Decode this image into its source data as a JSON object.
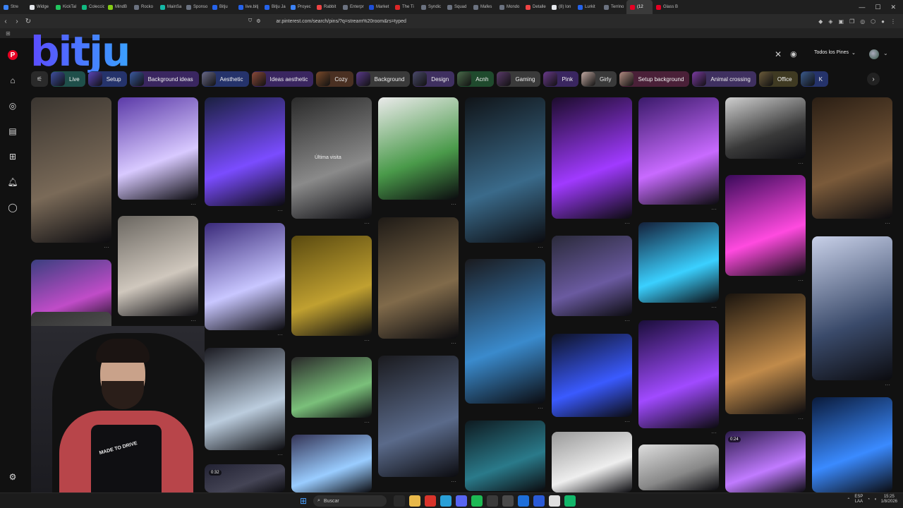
{
  "browser": {
    "tabs": [
      {
        "label": "Stre",
        "color": "#3b82f6"
      },
      {
        "label": "Widge",
        "color": "#e5e7eb"
      },
      {
        "label": "KickTal",
        "color": "#22c55e"
      },
      {
        "label": "Coleccio",
        "color": "#10b981"
      },
      {
        "label": "MindB",
        "color": "#84cc16"
      },
      {
        "label": "Rocko",
        "color": "#6b7280"
      },
      {
        "label": "MainSa",
        "color": "#14b8a6"
      },
      {
        "label": "Sponso",
        "color": "#6b7280"
      },
      {
        "label": "Bitju",
        "color": "#2563eb"
      },
      {
        "label": "live.bitj",
        "color": "#2563eb"
      },
      {
        "label": "Bitju Ja",
        "color": "#2563eb"
      },
      {
        "label": "Proyec",
        "color": "#3b82f6"
      },
      {
        "label": "Rabbit",
        "color": "#ef4444"
      },
      {
        "label": "Enterpr",
        "color": "#6b7280"
      },
      {
        "label": "Market",
        "color": "#1d4ed8"
      },
      {
        "label": "The Ti",
        "color": "#dc2626"
      },
      {
        "label": "Syndic",
        "color": "#6b7280"
      },
      {
        "label": "Squad",
        "color": "#6b7280"
      },
      {
        "label": "Mafes",
        "color": "#6b7280"
      },
      {
        "label": "Mondo",
        "color": "#6b7280"
      },
      {
        "label": "Detalle",
        "color": "#ef4444"
      },
      {
        "label": "(8) Ion",
        "color": "#e5e7eb"
      },
      {
        "label": "Lurkit",
        "color": "#2563eb"
      },
      {
        "label": "Terrino",
        "color": "#6b7280"
      },
      {
        "label": "(12",
        "color": "#e60023"
      },
      {
        "label": "Glass B",
        "color": "#e60023"
      }
    ],
    "url": "ar.pinterest.com/search/pins/?q=stream%20room&rs=typed",
    "window_controls": [
      "—",
      "☐",
      "✕"
    ]
  },
  "overlay": {
    "logo_text": "bitju"
  },
  "search": {
    "value": "",
    "filter_label": "Todos los Pines"
  },
  "chips": [
    {
      "label": "Live",
      "class": "teal",
      "thumb": "#3f4fa0"
    },
    {
      "label": "Setup",
      "class": "blue",
      "thumb": "#5a44b8"
    },
    {
      "label": "Background ideas",
      "class": "purple",
      "thumb": "#3b5aa0"
    },
    {
      "label": "Aesthetic",
      "class": "blue",
      "thumb": "#6a6a88"
    },
    {
      "label": "Ideas aesthetic",
      "class": "purple",
      "thumb": "#8a4a3a"
    },
    {
      "label": "Cozy",
      "class": "brown",
      "thumb": "#7a4a2a"
    },
    {
      "label": "Background",
      "class": "gray",
      "thumb": "#5a3a8a"
    },
    {
      "label": "Design",
      "class": "lav",
      "thumb": "#4a4a6a"
    },
    {
      "label": "Acnh",
      "class": "green",
      "thumb": "#4a6a4a"
    },
    {
      "label": "Gaming",
      "class": "gray",
      "thumb": "#5a3a6a"
    },
    {
      "label": "Pink",
      "class": "purple",
      "thumb": "#6a3a8a"
    },
    {
      "label": "Girly",
      "class": "gray",
      "thumb": "#bfa7a0"
    },
    {
      "label": "Setup background",
      "class": "pink",
      "thumb": "#b08a80"
    },
    {
      "label": "Animal crossing",
      "class": "lav",
      "thumb": "#7a3aa0"
    },
    {
      "label": "Office",
      "class": "olive",
      "thumb": "#6a5a3a"
    },
    {
      "label": "K",
      "class": "blue",
      "thumb": "#3a5a8a"
    }
  ],
  "grid": {
    "visit_label": "Última visita",
    "video_badges": [
      "0:32",
      "0:24"
    ]
  },
  "webcam": {
    "shirt_text": "MADE TO DRIVE"
  },
  "taskbar": {
    "search_label": "Buscar",
    "language": "ESP\nLAA",
    "time": "15:25",
    "date": "1/8/2026"
  },
  "colors": {
    "pinterest_red": "#e60023",
    "background": "#111111"
  }
}
